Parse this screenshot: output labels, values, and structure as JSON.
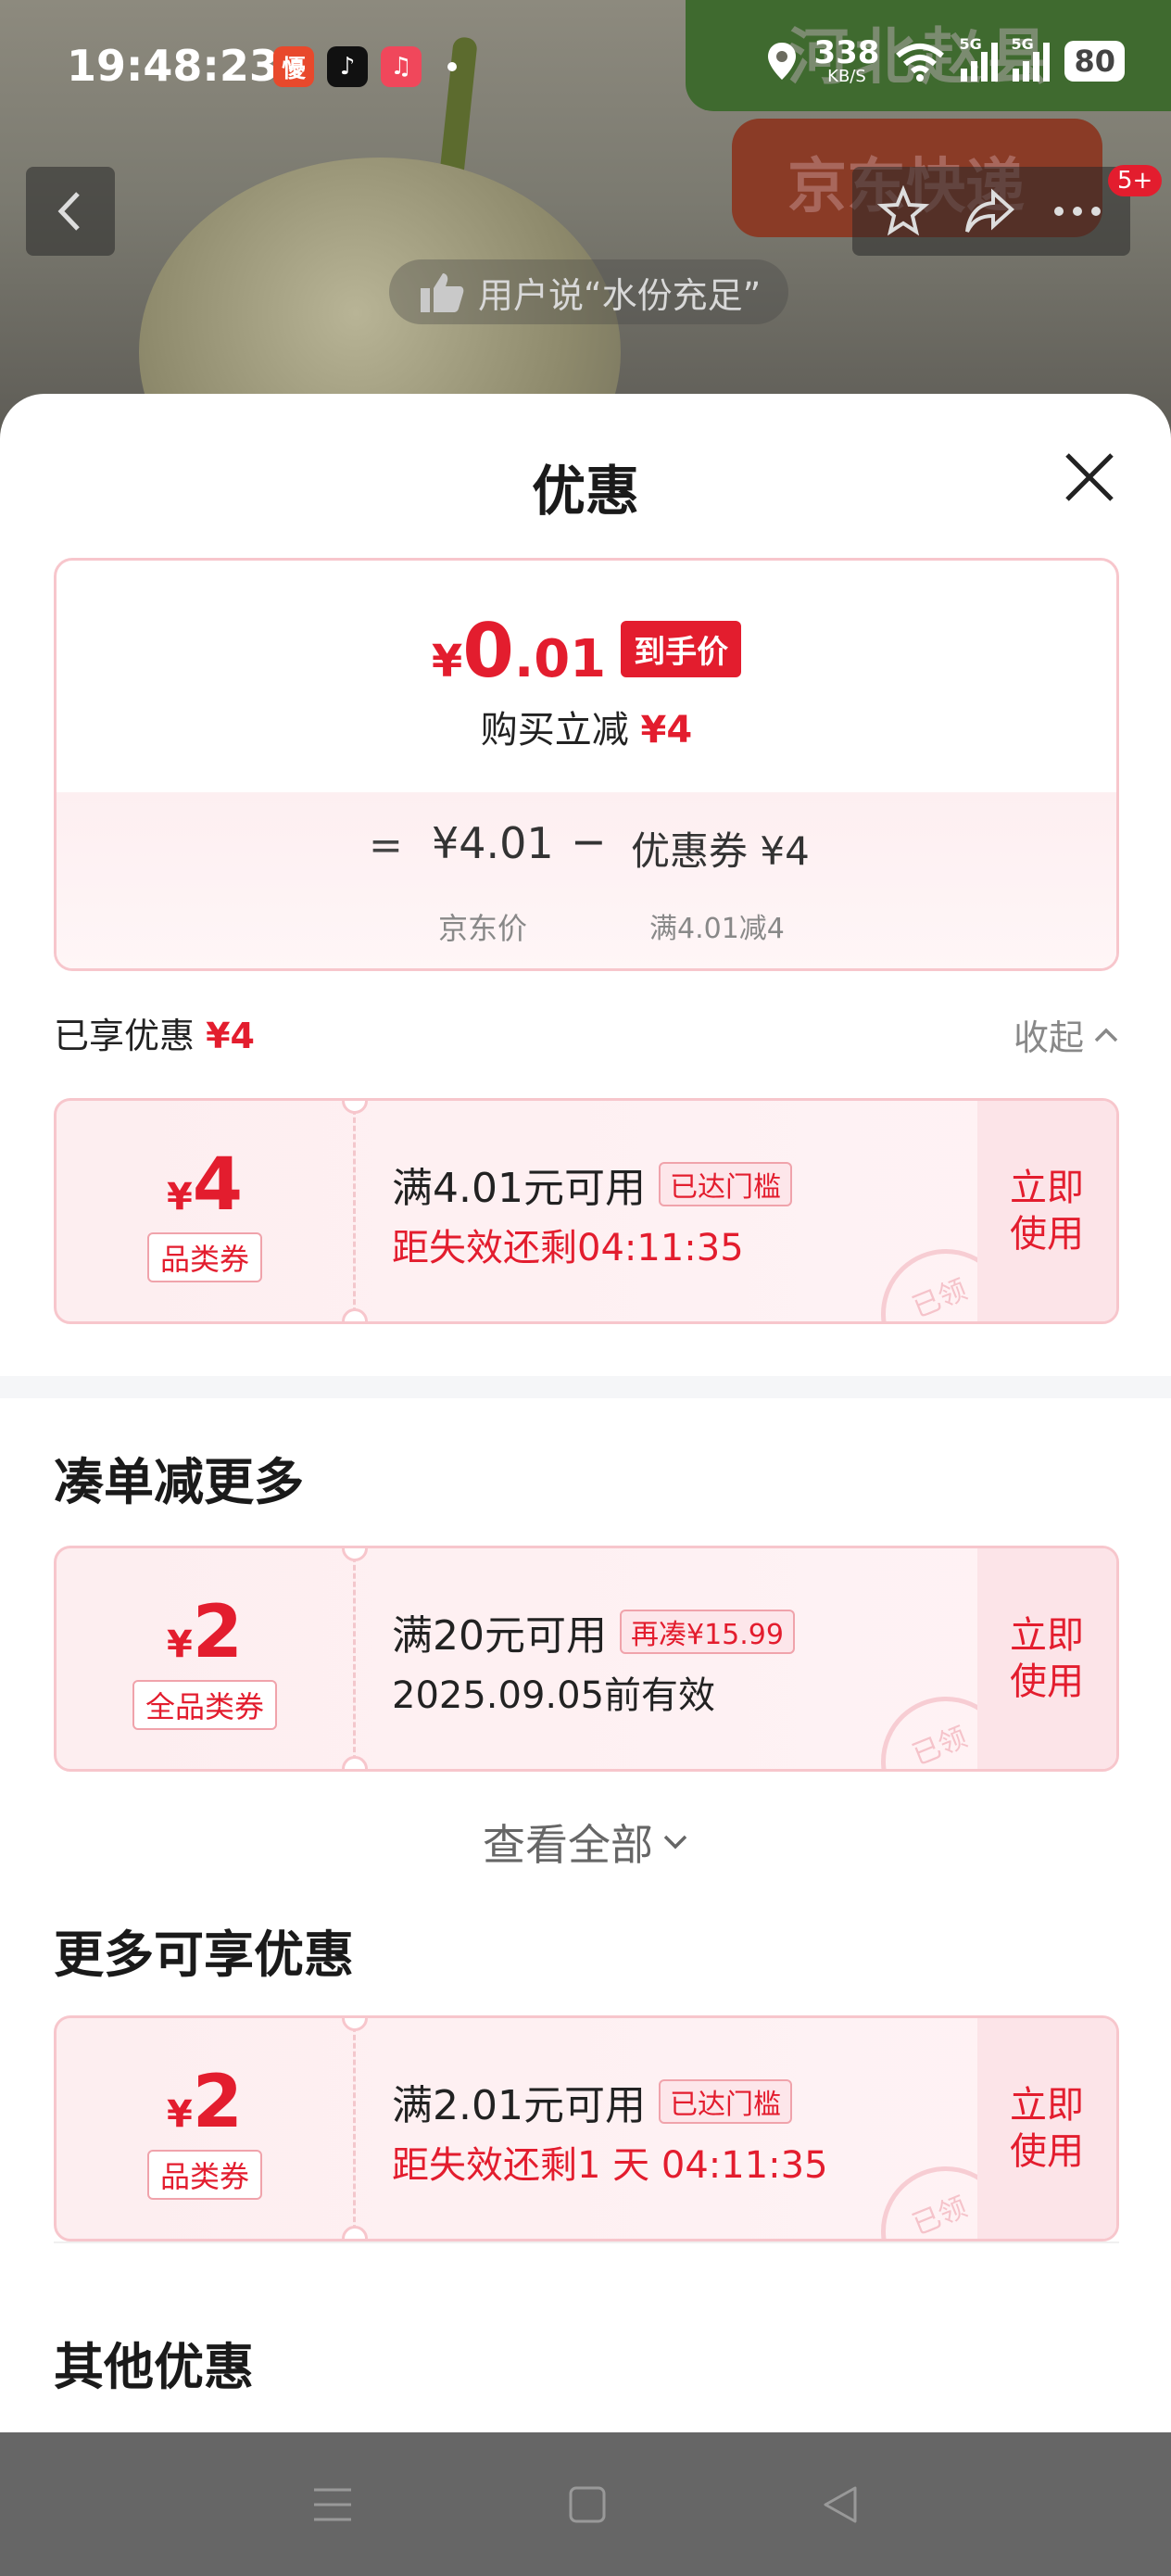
{
  "status_bar": {
    "time": "19:48:23",
    "net_speed": "338",
    "net_unit": "KB/S",
    "sig1": "5G",
    "sig2": "5G",
    "battery": "80",
    "app_icons": [
      "xiaohongshu-app",
      "tiktok-app",
      "music-app"
    ]
  },
  "background": {
    "store_sign": "河北赵县",
    "delivery": "京东快递",
    "review_text": "用户说“水份充足”",
    "badge": "5+"
  },
  "sheet": {
    "title": "优惠",
    "summary": {
      "currency": "¥",
      "price_int": "0",
      "price_dec": ".01",
      "price_tag": "到手价",
      "reduce_label": "购买立减",
      "reduce_amount": "¥4",
      "equals": "=",
      "jd_price": "¥4.01",
      "minus": "−",
      "coupon_label": "优惠券 ¥4",
      "jd_price_caption": "京东价",
      "coupon_caption": "满4.01减4"
    },
    "enjoyed": {
      "label": "已享优惠",
      "amount": "¥4",
      "collapse": "收起"
    },
    "coupons_enjoyed": [
      {
        "currency": "¥",
        "value": "4",
        "kind": "品类券",
        "condition": "满4.01元可用",
        "flag": "已达门槛",
        "sub": "距失效还剩04:11:35",
        "use_label": "立即使用",
        "stamp": "已领"
      }
    ],
    "section_more": {
      "title": "凑单减更多",
      "coupons": [
        {
          "currency": "¥",
          "value": "2",
          "kind": "全品类券",
          "condition": "满20元可用",
          "flag": "再凑¥15.99",
          "sub": "2025.09.05前有效",
          "use_label": "立即使用",
          "stamp": "已领"
        }
      ],
      "view_all": "查看全部"
    },
    "section_available": {
      "title": "更多可享优惠",
      "coupons": [
        {
          "currency": "¥",
          "value": "2",
          "kind": "品类券",
          "condition": "满2.01元可用",
          "flag": "已达门槛",
          "sub": "距失效还剩1 天 04:11:35",
          "use_label": "立即使用",
          "stamp": "已领"
        }
      ]
    },
    "section_other": {
      "title": "其他优惠"
    }
  },
  "colors": {
    "accent": "#e31d2e",
    "coupon_bg": "#fdeef0",
    "coupon_border": "#f7c6cc"
  }
}
